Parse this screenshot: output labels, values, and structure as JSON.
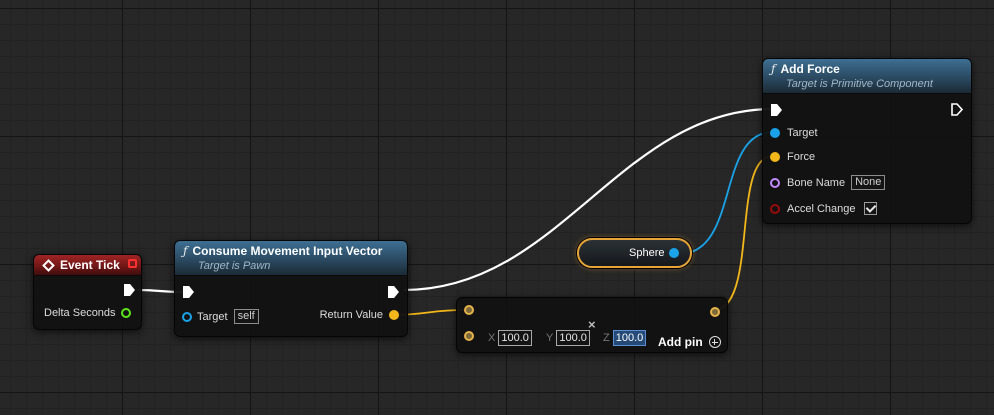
{
  "colors": {
    "exec": "#ffffff",
    "object_pin": "#1aa3e8",
    "vector_pin": "#f2b71a",
    "name_pin": "#c48bff",
    "bool_pin": "#9a0a0a",
    "float_pin": "#5ce61a",
    "selection_outline": "#e7a437"
  },
  "event_tick": {
    "title": "Event Tick",
    "delta_seconds": "Delta Seconds"
  },
  "consume_node": {
    "title": "Consume Movement Input Vector",
    "subtitle": "Target is Pawn",
    "target_label": "Target",
    "target_default": "self",
    "return_label": "Return Value"
  },
  "add_force": {
    "title": "Add Force",
    "subtitle": "Target is Primitive Component",
    "target_label": "Target",
    "force_label": "Force",
    "bone_label": "Bone Name",
    "bone_default": "None",
    "accel_label": "Accel Change",
    "accel_checked": true
  },
  "sphere_node": {
    "label": "Sphere"
  },
  "make_vector": {
    "x_label": "X",
    "x_value": "100.0",
    "y_label": "Y",
    "y_value": "100.0",
    "z_label": "Z",
    "z_value": "100.0",
    "add_pin_label": "Add pin"
  }
}
